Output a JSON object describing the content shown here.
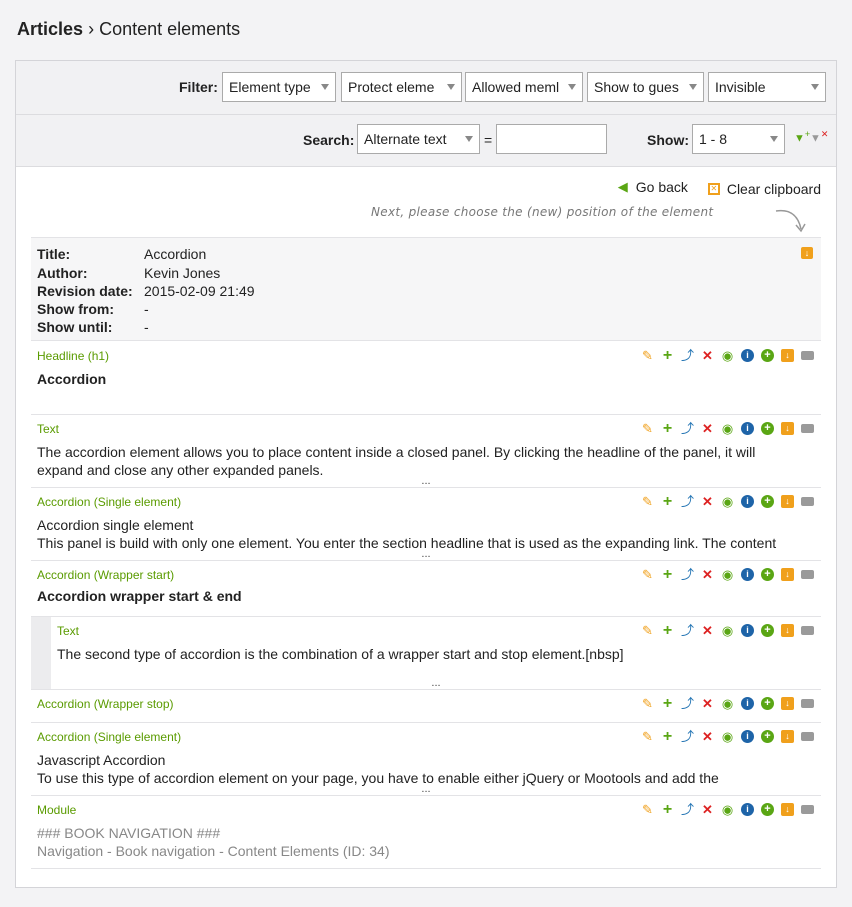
{
  "breadcrumb": {
    "parent": "Articles",
    "separator": "›",
    "current": "Content elements"
  },
  "filter": {
    "label": "Filter:",
    "selects": [
      "Element type",
      "Protect eleme",
      "Allowed meml",
      "Show to gues",
      "Invisible"
    ]
  },
  "search": {
    "label": "Search:",
    "field": "Alternate text",
    "operator": "=",
    "value": "",
    "show_label": "Show:",
    "show_value": "1 - 8"
  },
  "actions": {
    "go_back": "Go back",
    "clear_clipboard": "Clear clipboard"
  },
  "note": "Next, please choose the (new) position of the element",
  "info": {
    "title_k": "Title:",
    "title_v": "Accordion",
    "author_k": "Author:",
    "author_v": "Kevin Jones",
    "rev_k": "Revision date:",
    "rev_v": "2015-02-09 21:49",
    "from_k": "Show from:",
    "from_v": "-",
    "until_k": "Show until:",
    "until_v": "-"
  },
  "elements": [
    {
      "type": "Headline (h1)",
      "line1": "Accordion"
    },
    {
      "type": "Text",
      "line1": "The accordion element allows you to place content inside a closed panel. By clicking the headline of the panel, it will",
      "line2": "expand and close any other expanded panels.",
      "ellipsis": "..."
    },
    {
      "type": "Accordion (Single element)",
      "line1": "Accordion single element",
      "line2": "This panel is build with only one element. You enter the section headline that is used as the expanding link. The content",
      "ellipsis": "..."
    },
    {
      "type": "Accordion (Wrapper start)",
      "line1": "Accordion wrapper start & end"
    },
    {
      "type": "Text",
      "line1": "The second type of accordion is the combination of a wrapper start and stop element.[nbsp]",
      "ellipsis": "..."
    },
    {
      "type": "Accordion (Wrapper stop)"
    },
    {
      "type": "Accordion (Single element)",
      "line1": "Javascript Accordion",
      "line2": "To use this type of accordion element on your page, you have to enable either jQuery or Mootools and add the",
      "ellipsis": "..."
    },
    {
      "type": "Module",
      "line1": "### BOOK NAVIGATION ###",
      "line2": "Navigation - Book navigation - Content Elements (ID: 34)"
    }
  ],
  "icons": [
    "edit-icon",
    "add-icon",
    "cut-icon",
    "delete-icon",
    "toggle-visibility-icon",
    "info-icon",
    "insert-after-icon",
    "paste-icon",
    "drag-handle-icon"
  ],
  "colors": {
    "type_label": "#5a9b00",
    "edit": "#f0a01c",
    "add": "#5aa614",
    "delete": "#dd2222",
    "info": "#1e64a8"
  }
}
